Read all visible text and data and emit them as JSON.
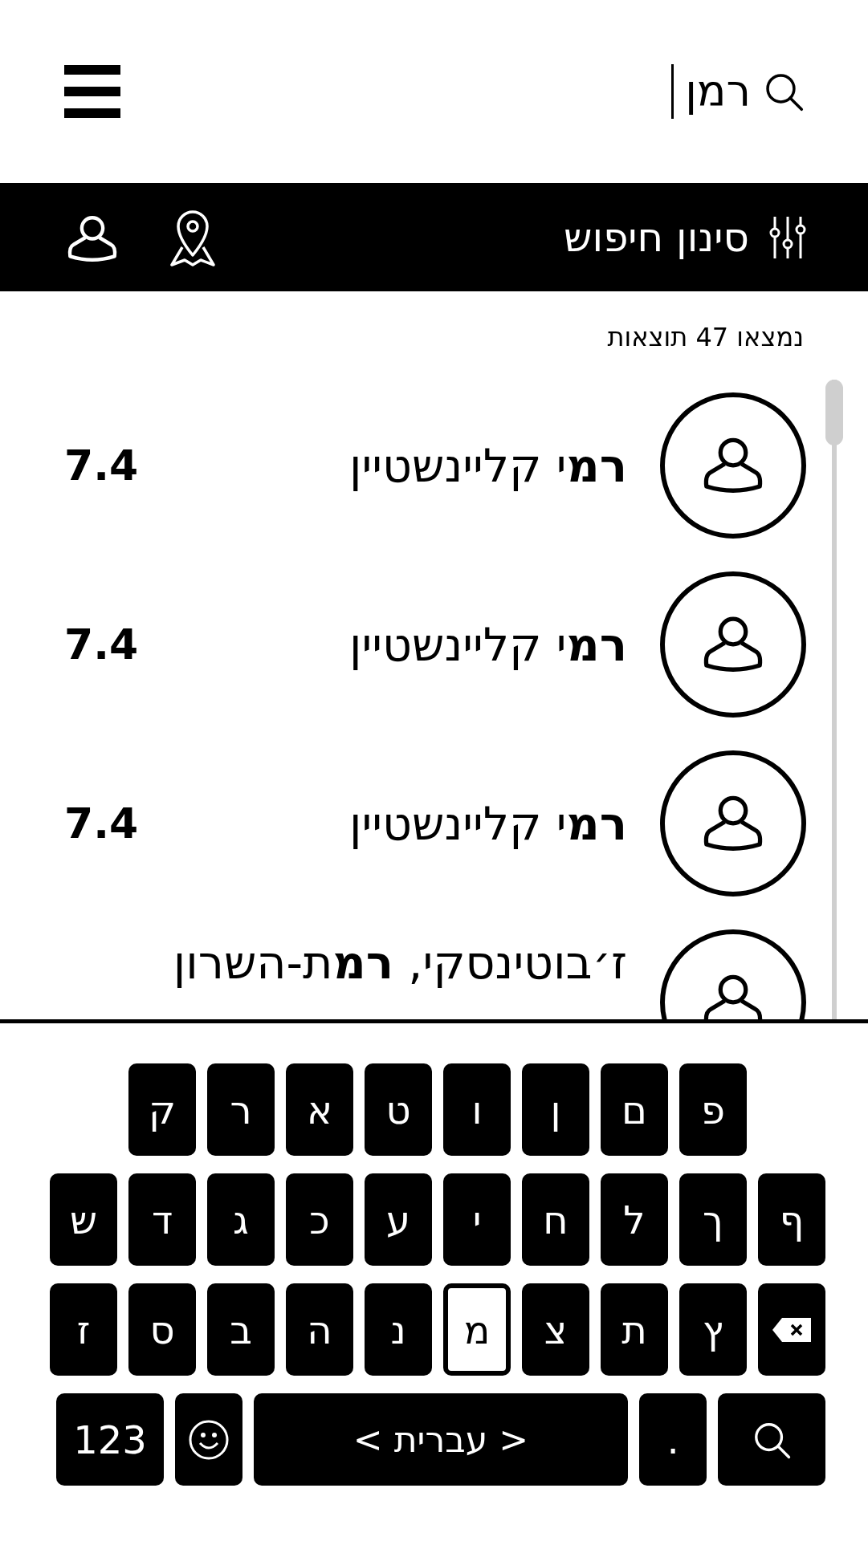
{
  "menu": {
    "kind": "hamburger"
  },
  "search": {
    "value": "רמן"
  },
  "filter_bar": {
    "label": "סינון חיפוש"
  },
  "result_count": "נמצאו 47 תוצאות",
  "results": [
    {
      "title": "**רמ**י קליינשטיין",
      "score": "7.4"
    },
    {
      "title": "**רמ**י קליינשטיין",
      "score": "7.4"
    },
    {
      "title": "**רמ**י קליינשטיין",
      "score": "7.4"
    },
    {
      "title": "ז׳בוטינסקי, **רמ**ת-השרון"
    }
  ],
  "keyboard": {
    "rows": [
      [
        "",
        {
          "kind": "letter",
          "label": "פ",
          "selected": false
        },
        {
          "kind": "letter",
          "label": "ם",
          "selected": false
        },
        {
          "kind": "letter",
          "label": "ן",
          "selected": false
        },
        {
          "kind": "letter",
          "label": "ו",
          "selected": false
        },
        {
          "kind": "letter",
          "label": "ט",
          "selected": false
        },
        {
          "kind": "letter",
          "label": "א",
          "selected": false
        },
        {
          "kind": "letter",
          "label": "ר",
          "selected": false
        },
        {
          "kind": "letter",
          "label": "ק",
          "selected": false
        }
      ],
      [
        {
          "kind": "letter",
          "label": "ף",
          "selected": false
        },
        {
          "kind": "letter",
          "label": "ך",
          "selected": false
        },
        {
          "kind": "letter",
          "label": "ל",
          "selected": false
        },
        {
          "kind": "letter",
          "label": "ח",
          "selected": false
        },
        {
          "kind": "letter",
          "label": "י",
          "selected": false
        },
        {
          "kind": "letter",
          "label": "ע",
          "selected": false
        },
        {
          "kind": "letter",
          "label": "כ",
          "selected": false
        },
        {
          "kind": "letter",
          "label": "ג",
          "selected": false
        },
        {
          "kind": "letter",
          "label": "ד",
          "selected": false
        },
        {
          "kind": "letter",
          "label": "ש",
          "selected": false
        }
      ],
      [
        {
          "kind": "backspace"
        },
        {
          "kind": "letter",
          "label": "ץ",
          "selected": false
        },
        {
          "kind": "letter",
          "label": "ת",
          "selected": false
        },
        {
          "kind": "letter",
          "label": "צ",
          "selected": false
        },
        {
          "kind": "letter",
          "label": "מ",
          "selected": true
        },
        {
          "kind": "letter",
          "label": "נ",
          "selected": false
        },
        {
          "kind": "letter",
          "label": "ה",
          "selected": false
        },
        {
          "kind": "letter",
          "label": "ב",
          "selected": false
        },
        {
          "kind": "letter",
          "label": "ס",
          "selected": false
        },
        {
          "kind": "letter",
          "label": "ז",
          "selected": false
        }
      ]
    ],
    "bottom_keys": [
      {
        "kind": "search"
      },
      {
        "kind": "letter",
        "label": ".",
        "selected": false
      },
      {
        "kind": "space",
        "label": "< עברית >"
      },
      {
        "kind": "emoji"
      },
      {
        "kind": "wide",
        "label": "123"
      }
    ]
  }
}
